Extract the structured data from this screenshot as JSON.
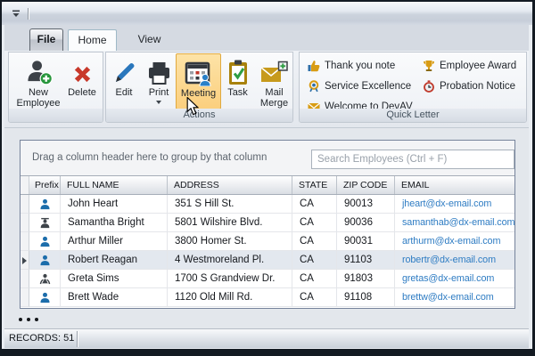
{
  "ribbon": {
    "tabs": {
      "file": "File",
      "home": "Home",
      "view": "View"
    },
    "groups": {
      "employees": {
        "label": "",
        "new_employee": "New Employee",
        "delete": "Delete"
      },
      "actions": {
        "label": "Actions",
        "edit": "Edit",
        "print": "Print",
        "meeting": "Meeting",
        "task": "Task",
        "mail_merge": "Mail Merge"
      },
      "quick_letter": {
        "label": "Quick Letter",
        "items": [
          "Thank you note",
          "Service Excellence",
          "Welcome to DevAV",
          "Employee Award",
          "Probation Notice"
        ]
      }
    },
    "highlight_color": "#FBD089"
  },
  "grid": {
    "groupby_hint": "Drag a column header here to group by that column",
    "search_placeholder": "Search Employees (Ctrl + F)",
    "columns": [
      "Prefix",
      "FULL NAME",
      "ADDRESS",
      "STATE",
      "ZIP CODE",
      "EMAIL"
    ],
    "rows": [
      {
        "prefix_icon": "male-person",
        "name": "John Heart",
        "address": "351 S Hill St.",
        "state": "CA",
        "zip": "90013",
        "email": "jheart@dx-email.com",
        "selected": false
      },
      {
        "prefix_icon": "doctor-person",
        "name": "Samantha Bright",
        "address": "5801 Wilshire Blvd.",
        "state": "CA",
        "zip": "90036",
        "email": "samanthab@dx-email.com",
        "selected": false
      },
      {
        "prefix_icon": "male-person",
        "name": "Arthur Miller",
        "address": "3800 Homer St.",
        "state": "CA",
        "zip": "90031",
        "email": "arthurm@dx-email.com",
        "selected": false
      },
      {
        "prefix_icon": "male-person",
        "name": "Robert Reagan",
        "address": "4 Westmoreland Pl.",
        "state": "CA",
        "zip": "91103",
        "email": "robertr@dx-email.com",
        "selected": true
      },
      {
        "prefix_icon": "female-person",
        "name": "Greta Sims",
        "address": "1700 S Grandview Dr.",
        "state": "CA",
        "zip": "91803",
        "email": "gretas@dx-email.com",
        "selected": false
      },
      {
        "prefix_icon": "male-person",
        "name": "Brett Wade",
        "address": "1120 Old Mill Rd.",
        "state": "CA",
        "zip": "91108",
        "email": "brettw@dx-email.com",
        "selected": false
      }
    ],
    "email_link_color": "#2E7CC3"
  },
  "statusbar": {
    "records": "RECORDS: 51"
  }
}
